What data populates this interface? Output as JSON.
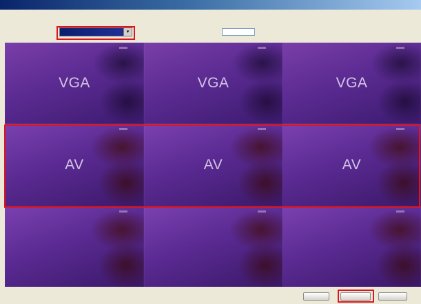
{
  "window": {
    "title": ""
  },
  "instruction": {
    "text": ""
  },
  "controls": {
    "select_label": "",
    "select_value": "",
    "name_label": "",
    "name_value": ""
  },
  "grid": {
    "rows": [
      {
        "cells": [
          "VGA",
          "VGA",
          "VGA"
        ]
      },
      {
        "cells": [
          "AV",
          "AV",
          "AV"
        ]
      },
      {
        "cells": [
          "",
          "",
          ""
        ]
      }
    ]
  },
  "buttons": {
    "back_label": "",
    "next_label": "",
    "cancel_label": ""
  },
  "colors": {
    "highlight": "#e0141c",
    "titlebar": "#0a246a",
    "tile_purple": "#5a2a92"
  },
  "icons": {
    "select_arrow": "chevron-down-icon"
  }
}
